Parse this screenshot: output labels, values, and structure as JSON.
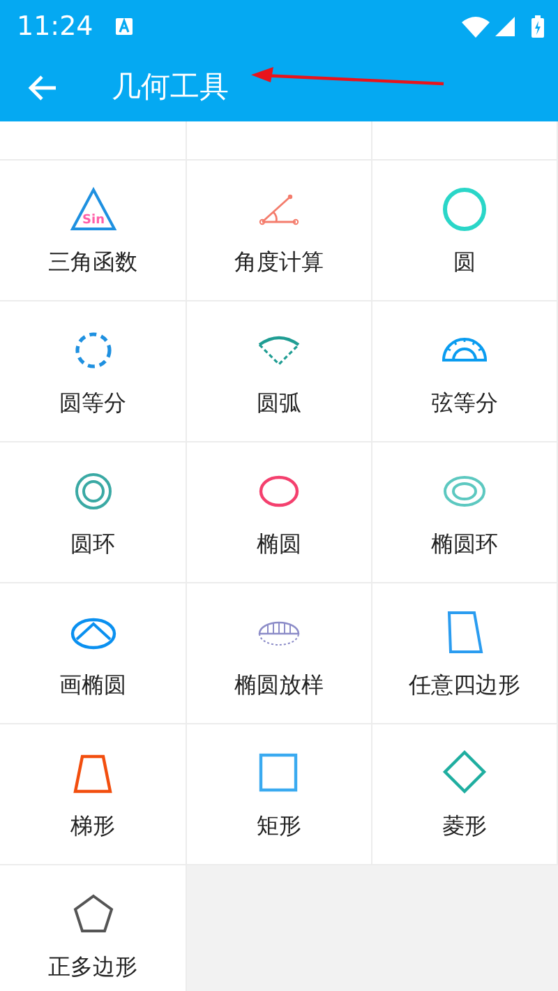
{
  "status_bar": {
    "time": "11:24"
  },
  "app_bar": {
    "title": "几何工具"
  },
  "tools": [
    {
      "label": "三角函数",
      "icon_text": "Sin"
    },
    {
      "label": "角度计算"
    },
    {
      "label": "圆"
    },
    {
      "label": "圆等分"
    },
    {
      "label": "圆弧"
    },
    {
      "label": "弦等分"
    },
    {
      "label": "圆环"
    },
    {
      "label": "椭圆"
    },
    {
      "label": "椭圆环"
    },
    {
      "label": "画椭圆"
    },
    {
      "label": "椭圆放样"
    },
    {
      "label": "任意四边形"
    },
    {
      "label": "梯形"
    },
    {
      "label": "矩形"
    },
    {
      "label": "菱形"
    },
    {
      "label": "正多边形"
    }
  ]
}
